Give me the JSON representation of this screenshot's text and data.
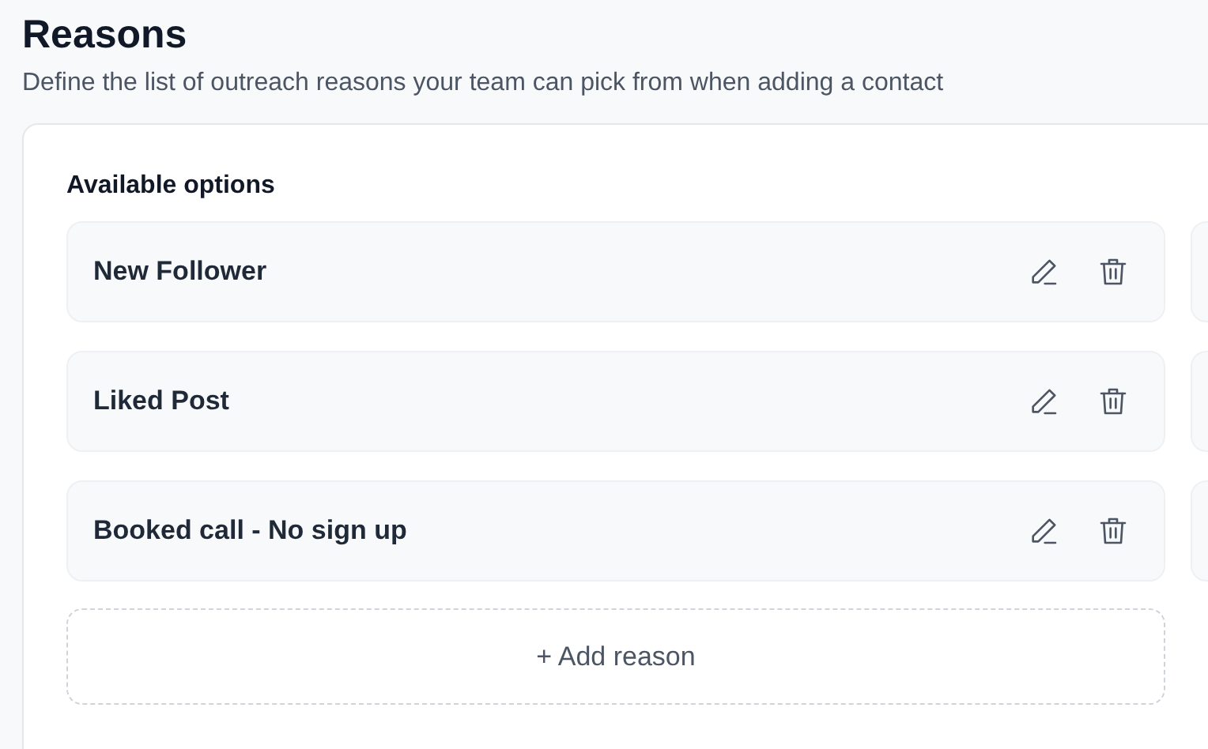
{
  "header": {
    "title": "Reasons",
    "subtitle": "Define the list of outreach reasons your team can pick from when adding a contact"
  },
  "options": {
    "heading": "Available options",
    "items": [
      {
        "label": "New Follower"
      },
      {
        "label": "Liked Post"
      },
      {
        "label": "Booked call - No sign up"
      }
    ],
    "add_button": "+ Add reason"
  }
}
